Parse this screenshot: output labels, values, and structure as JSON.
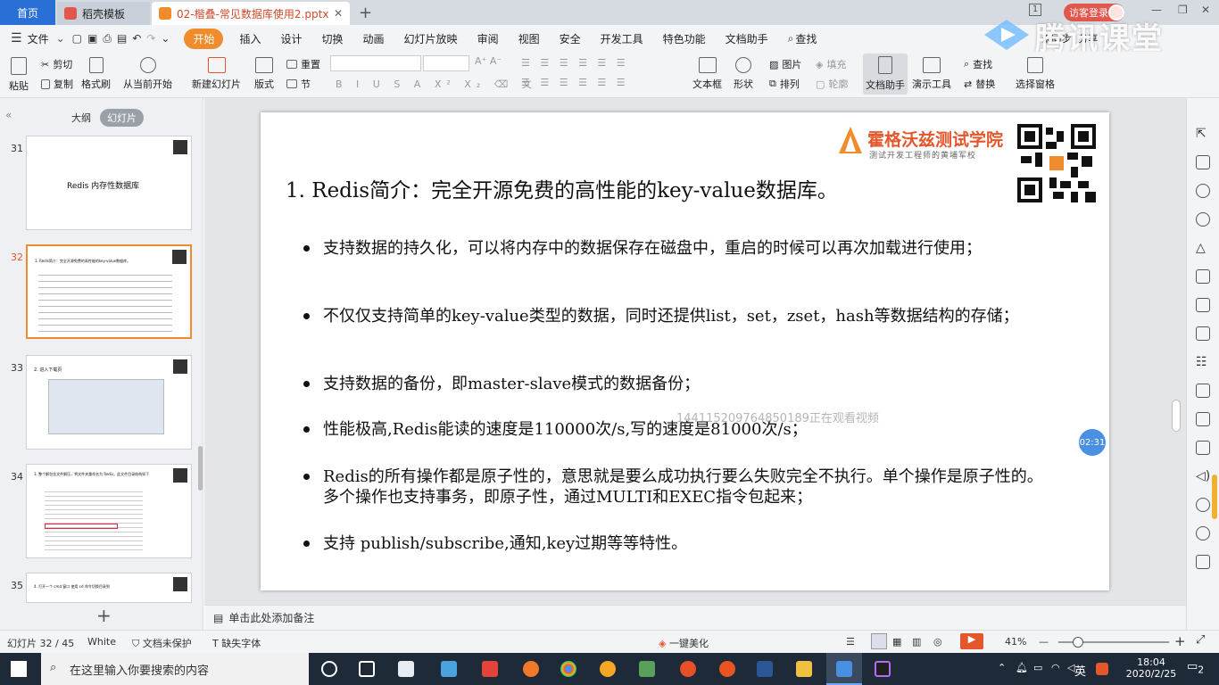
{
  "tabs": {
    "home": "首页",
    "template": "稻壳模板",
    "file": "02-楷叠-常见数据库使用2.pptx",
    "page_badge": "1",
    "login": "访客登录"
  },
  "watermark": "腾讯课堂",
  "menu": {
    "file": "文件",
    "items": [
      "开始",
      "插入",
      "设计",
      "切换",
      "动画",
      "幻灯片放映",
      "审阅",
      "视图",
      "安全",
      "开发工具",
      "特色功能",
      "文档助手"
    ],
    "search": "查找",
    "right": [
      "未同步",
      "分享"
    ]
  },
  "ribbon": {
    "paste": "粘贴",
    "cut": "剪切",
    "copy": "复制",
    "format_painter": "格式刷",
    "from_current": "从当前开始",
    "new_slide": "新建幻灯片",
    "layout": "版式",
    "reset": "重置",
    "section": "节",
    "textbox": "文本框",
    "shape": "形状",
    "picture": "图片",
    "fill": "填充",
    "arrange": "排列",
    "outline": "轮廓",
    "doc_assistant": "文档助手",
    "presentation_tools": "演示工具",
    "find": "查找",
    "replace": "替换",
    "select_pane": "选择窗格"
  },
  "left_panel": {
    "outline": "大纲",
    "slides": "幻灯片",
    "thumbnails": [
      {
        "num": "31",
        "text": "Redis 内存性数据库"
      },
      {
        "num": "32",
        "text": "1. Redis简介：完全开源免费的高性能的key-value数据库。"
      },
      {
        "num": "33",
        "text": "2. 进入下载页"
      },
      {
        "num": "34",
        "text": "3. 整个解包含文件解压，将文件夹重命名为 Redis，此文件目录结构如下"
      },
      {
        "num": "35",
        "text": "4. 打开一个 cmd 窗口 使用 cd 命令切换目录到"
      }
    ]
  },
  "slide": {
    "logo_name": "霍格沃兹测试学院",
    "logo_sub": "测试开发工程师的黄埔军校",
    "title": "1.  Redis简介：完全开源免费的高性能的key-value数据库。",
    "bullets": [
      "支持数据的持久化，可以将内存中的数据保存在磁盘中，重启的时候可以再次加载进行使用；",
      "不仅仅支持简单的key-value类型的数据，同时还提供list，set，zset，hash等数据结构的存储；",
      "支持数据的备份，即master-slave模式的数据备份；",
      "性能极高,Redis能读的速度是110000次/s,写的速度是81000次/s；",
      "Redis的所有操作都是原子性的，意思就是要么成功执行要么失败完全不执行。单个操作是原子性的。多个操作也支持事务，即原子性，通过MULTI和EXEC指令包起来；",
      "支持 publish/subscribe,通知,key过期等等特性。"
    ]
  },
  "overlay": {
    "viewer": "144115209764850189正在观看视频",
    "timer": "02:31"
  },
  "notes": "单击此处添加备注",
  "status": {
    "slide_pos": "幻灯片 32 / 45",
    "theme": "White",
    "protect": "文档未保护",
    "missing_font": "缺失字体",
    "beautify": "一键美化",
    "zoom": "41%"
  },
  "taskbar": {
    "search_placeholder": "在这里输入你要搜索的内容",
    "ime": "英",
    "time": "18:04",
    "date": "2020/2/25",
    "notify": "2"
  },
  "colors": {
    "accent": "#f08c2b",
    "home_tab": "#2a6fd6",
    "login": "#e2574c"
  }
}
